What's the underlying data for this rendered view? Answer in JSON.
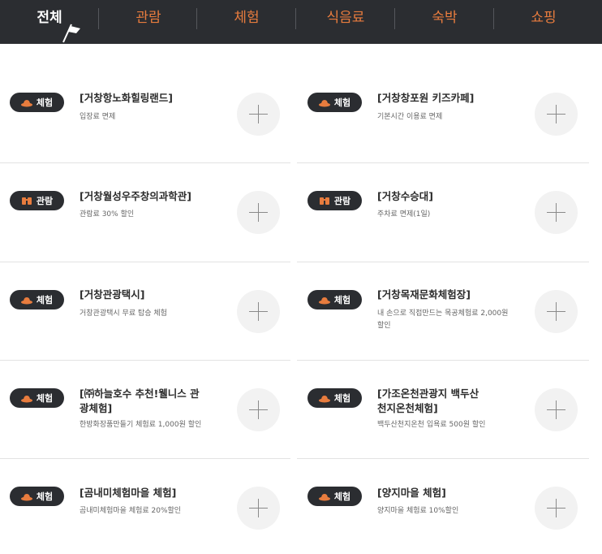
{
  "nav": {
    "tabs": [
      {
        "label": "전체",
        "active": true
      },
      {
        "label": "관람"
      },
      {
        "label": "체험"
      },
      {
        "label": "식음료"
      },
      {
        "label": "숙박"
      },
      {
        "label": "쇼핑"
      }
    ]
  },
  "colors": {
    "accent": "#e87c3e",
    "dark": "#2b2d31"
  },
  "items": [
    {
      "category": "체험",
      "icon": "hat-icon",
      "title": "[거창항노화힐링랜드]",
      "desc": "입장료 면제"
    },
    {
      "category": "체험",
      "icon": "hat-icon",
      "title": "[거창창포원 키즈카페]",
      "desc": "기본시간 이용료 면제"
    },
    {
      "category": "관람",
      "icon": "binoculars-icon",
      "title": "[거창월성우주창의과학관]",
      "desc": "관람료 30% 할인"
    },
    {
      "category": "관람",
      "icon": "binoculars-icon",
      "title": "[거창수승대]",
      "desc": "주차료 면제(1일)"
    },
    {
      "category": "체험",
      "icon": "hat-icon",
      "title": "[거창관광택시]",
      "desc": "거창관광택시 무료 탑승 체험"
    },
    {
      "category": "체험",
      "icon": "hat-icon",
      "title": "[거창목재문화체험장]",
      "desc": "내 손으로 직접만드는 목공체험료 2,000원 할인"
    },
    {
      "category": "체험",
      "icon": "hat-icon",
      "title": "[㈜하늘호수 추천!웰니스 관광체험]",
      "desc": "한방화장품만들기 체험료 1,000원 할인"
    },
    {
      "category": "체험",
      "icon": "hat-icon",
      "title": "[가조온천관광지 백두산천지온천체험]",
      "desc": "백두산천지온천 입욕료 500원 할인"
    },
    {
      "category": "체험",
      "icon": "hat-icon",
      "title": "[곰내미체험마을 체험]",
      "desc": "곰내미체험마을 체험료 20%할인"
    },
    {
      "category": "체험",
      "icon": "hat-icon",
      "title": "[양지마을 체험]",
      "desc": "양지마을 체험료 10%할인"
    }
  ]
}
